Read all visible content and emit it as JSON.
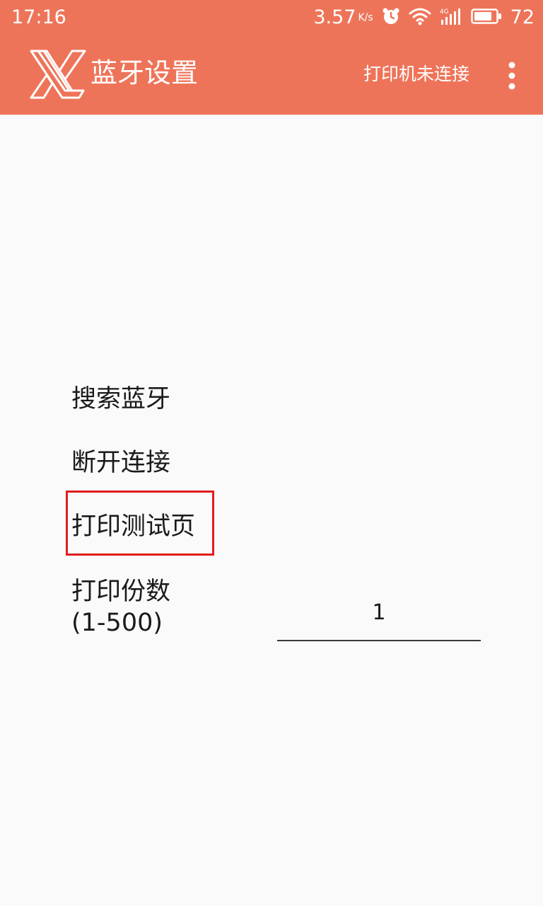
{
  "status_bar": {
    "time": "17:16",
    "net_speed": "3.57",
    "net_speed_unit": "K/s",
    "battery_level": "72",
    "icons": [
      "alarm-icon",
      "wifi-icon",
      "cellular-4g-icon",
      "battery-icon"
    ]
  },
  "toolbar": {
    "title": "蓝牙设置",
    "connection_status": "打印机未连接",
    "logo_icon": "app-logo-x-icon",
    "menu_icon": "overflow-menu-icon"
  },
  "menu": {
    "search_bluetooth": "搜索蓝牙",
    "disconnect": "断开连接",
    "print_test_page": "打印测试页"
  },
  "copies": {
    "label_line1": "打印份数",
    "label_line2": "(1-500)",
    "value": "1"
  },
  "colors": {
    "header_background": "#ee7459",
    "page_background": "#fafafa",
    "highlight_border": "#e21d1d"
  }
}
